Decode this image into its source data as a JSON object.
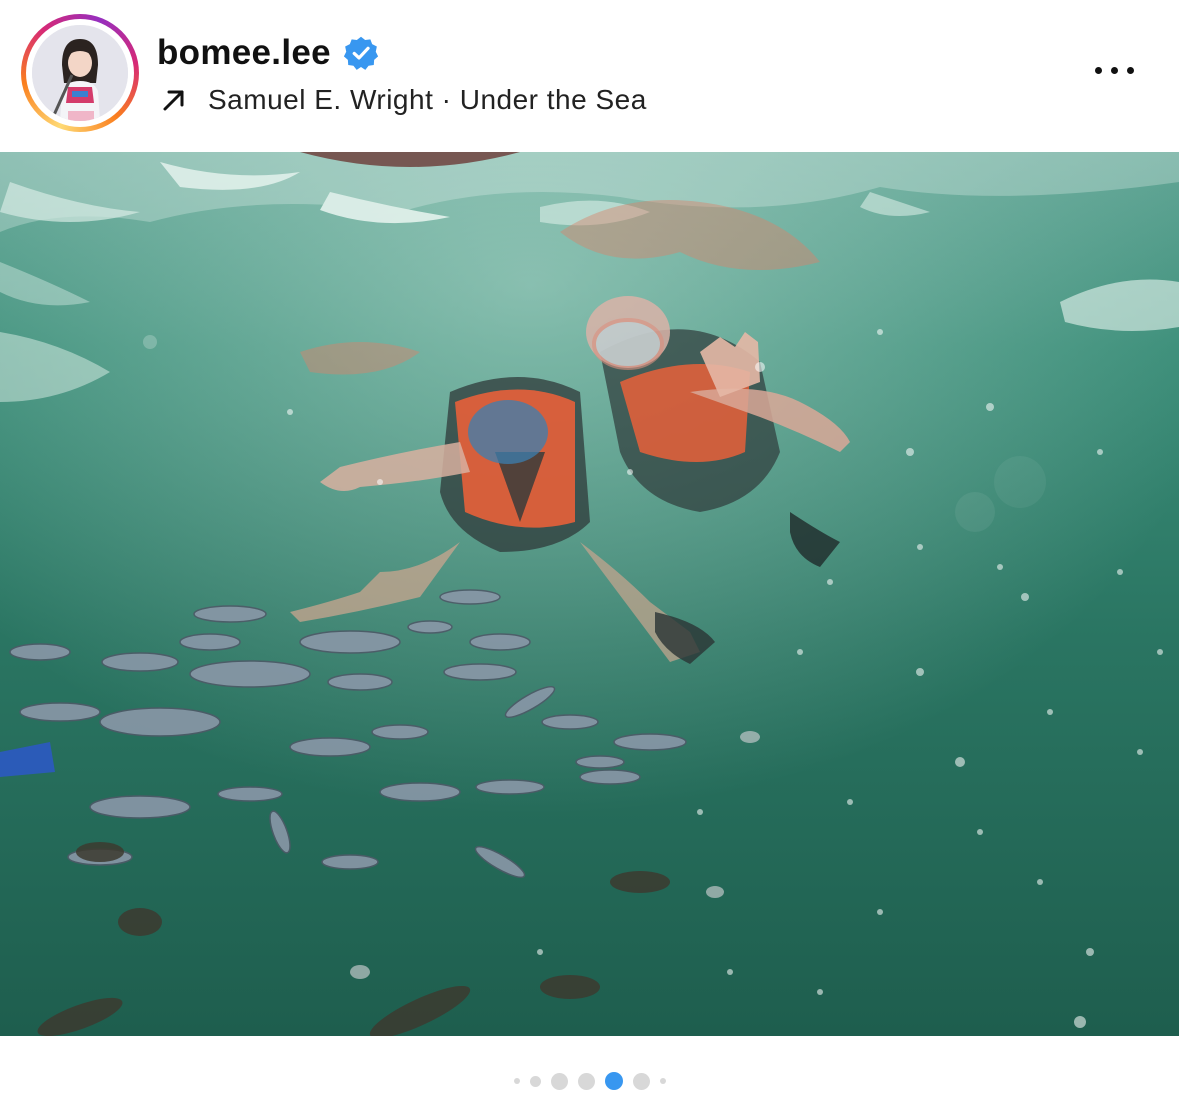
{
  "post": {
    "username": "bomee.lee",
    "verified": true,
    "audio": "Samuel E. Wright · Under the Sea",
    "more_icon": "more-horizontal-icon",
    "arrow_icon": "arrow-up-right-icon",
    "verified_icon": "verified-badge-icon",
    "mute_icon": "speaker-muted-icon",
    "carousel": {
      "count": 7,
      "active_index": 4
    }
  },
  "colors": {
    "verified": "#3897f0",
    "active_dot": "#3897f0",
    "inactive_dot": "#d8d8d8",
    "water": "#1f6b58",
    "life_vest": "#e8603a"
  }
}
